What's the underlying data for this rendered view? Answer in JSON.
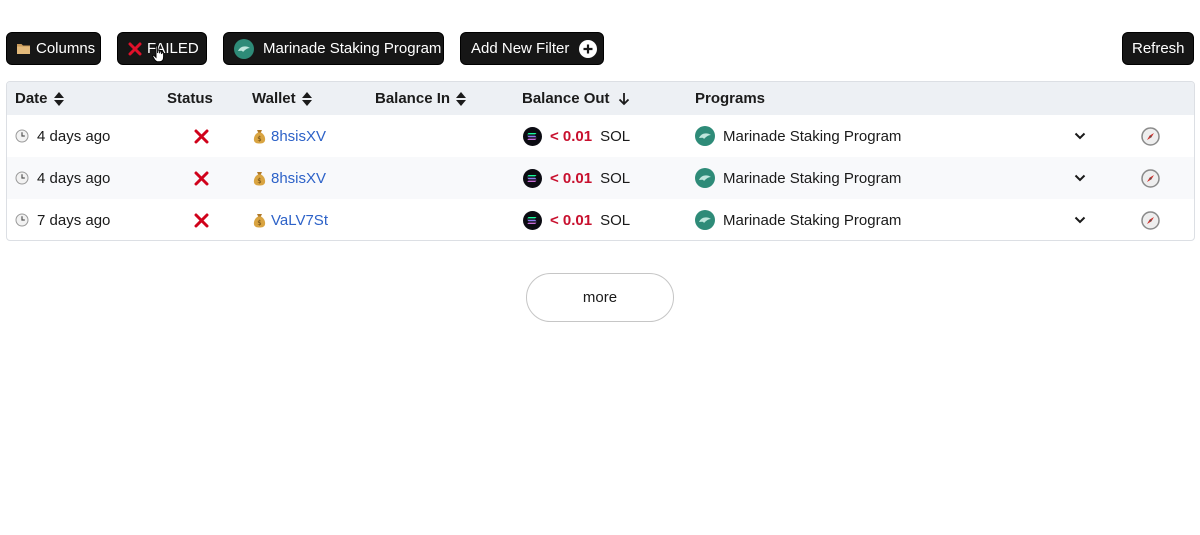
{
  "toolbar": {
    "columns_label": "Columns",
    "failed_label": "FAILED",
    "program_label": "Marinade Staking Program",
    "add_filter_label": "Add New Filter",
    "refresh_label": "Refresh"
  },
  "table": {
    "headers": {
      "date": "Date",
      "status": "Status",
      "wallet": "Wallet",
      "balance_in": "Balance In",
      "balance_out": "Balance Out",
      "programs": "Programs"
    },
    "rows": [
      {
        "date": "4 days ago",
        "wallet": "8hsisXV",
        "balance_out_amount": "< 0.01",
        "balance_out_unit": "SOL",
        "program": "Marinade Staking Program"
      },
      {
        "date": "4 days ago",
        "wallet": "8hsisXV",
        "balance_out_amount": "< 0.01",
        "balance_out_unit": "SOL",
        "program": "Marinade Staking Program"
      },
      {
        "date": "7 days ago",
        "wallet": "VaLV7St",
        "balance_out_amount": "< 0.01",
        "balance_out_unit": "SOL",
        "program": "Marinade Staking Program"
      }
    ]
  },
  "more_label": "more",
  "colors": {
    "button_bg": "#161616",
    "header_bg": "#edf0f4",
    "link": "#2d62c8",
    "failed_red": "#d0021b",
    "amount_red": "#c8102e",
    "marinade_teal": "#2e8b78"
  },
  "icons": {
    "columns": "folder-icon",
    "failed": "x-mark-icon",
    "program": "marinade-logo-icon",
    "add": "plus-circle-icon",
    "date": "clock-icon",
    "wallet": "money-bag-icon",
    "token": "solana-logo-icon",
    "expand": "chevron-down-icon",
    "explorer": "compass-icon"
  }
}
